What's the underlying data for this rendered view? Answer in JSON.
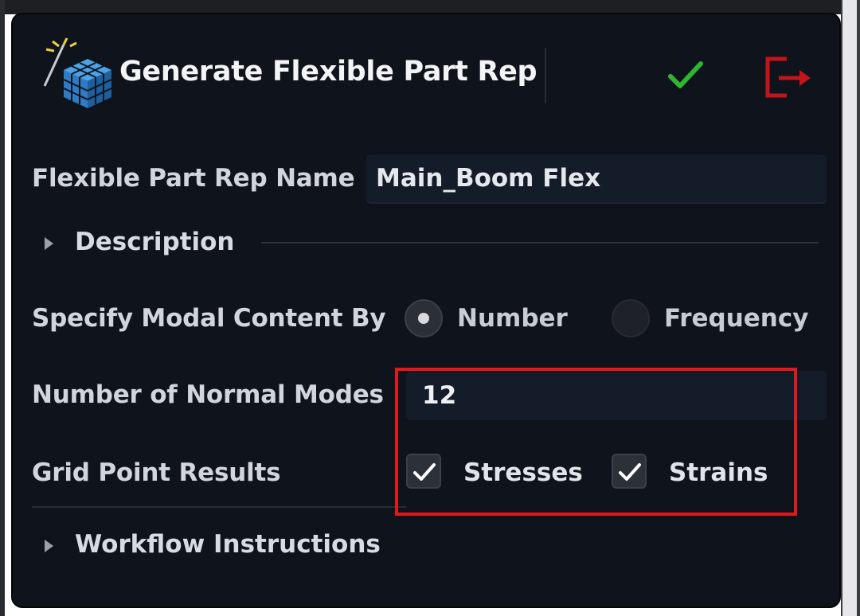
{
  "dialog": {
    "title": "Generate Flexible Part Rep",
    "icons": {
      "title_icon": "magic-wand-cube-icon",
      "ok_icon": "checkmark-icon",
      "exit_icon": "exit-door-icon"
    }
  },
  "fields": {
    "name_label": "Flexible Part Rep Name",
    "name_value": "Main_Boom Flex",
    "description_label": "Description",
    "modal_label": "Specify Modal Content By",
    "modal_options": [
      "Number",
      "Frequency"
    ],
    "modal_selected": "Number",
    "modes_label": "Number of Normal Modes",
    "modes_value": "12",
    "grid_label": "Grid Point Results",
    "grid_options": [
      {
        "label": "Stresses",
        "checked": true
      },
      {
        "label": "Strains",
        "checked": true
      }
    ],
    "workflow_label": "Workflow Instructions"
  },
  "colors": {
    "panel_bg": "#0f131b",
    "input_bg": "#141c2a",
    "ok_green": "#2fb52f",
    "exit_red": "#c4131b",
    "highlight_red": "#e1191d"
  }
}
